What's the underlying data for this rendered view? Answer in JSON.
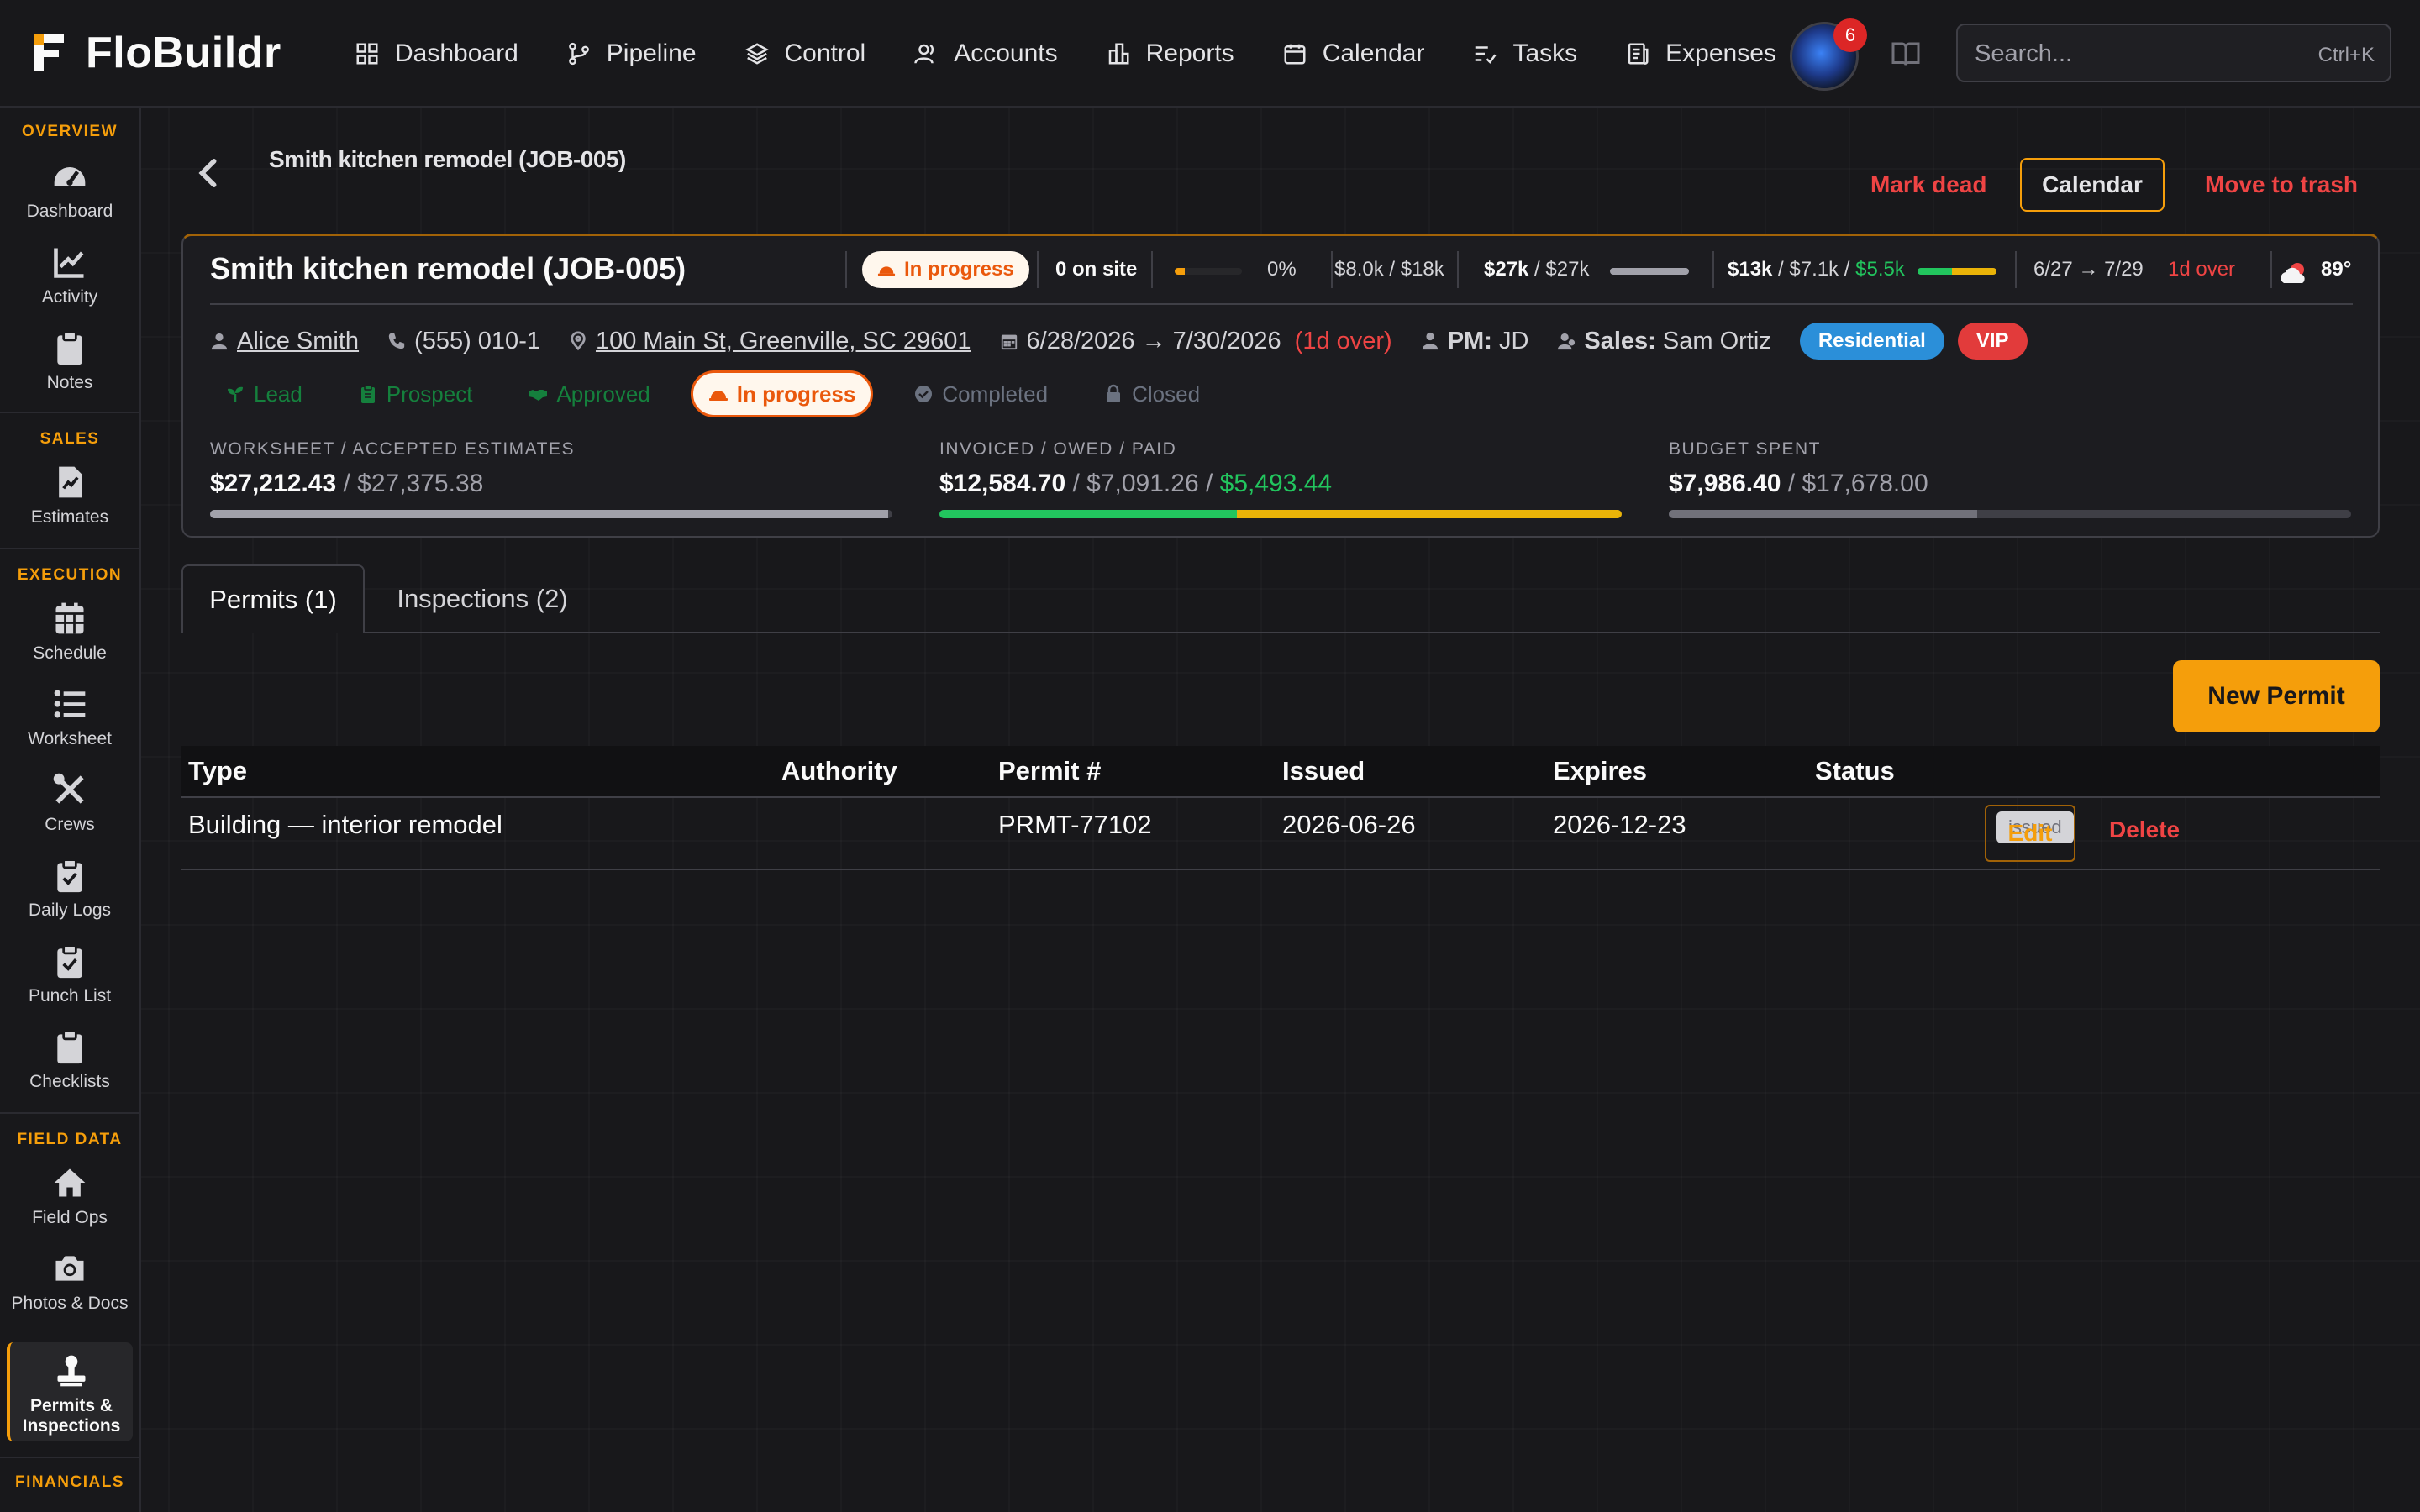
{
  "app": {
    "name": "FloBuildr"
  },
  "nav": [
    {
      "label": "Dashboard",
      "icon": "grid-icon"
    },
    {
      "label": "Pipeline",
      "icon": "branch-icon"
    },
    {
      "label": "Control",
      "icon": "layers-icon"
    },
    {
      "label": "Accounts",
      "icon": "users-icon"
    },
    {
      "label": "Reports",
      "icon": "building-icon"
    },
    {
      "label": "Calendar",
      "icon": "calendar-icon"
    },
    {
      "label": "Tasks",
      "icon": "tasks-icon"
    },
    {
      "label": "Expenses",
      "icon": "receipt-icon"
    }
  ],
  "notifications_count": "6",
  "search": {
    "placeholder": "Search...",
    "shortcut": "Ctrl+K"
  },
  "sidebar": {
    "sections": {
      "overview": "OVERVIEW",
      "sales": "SALES",
      "execution": "EXECUTION",
      "field_data": "FIELD DATA",
      "financials": "FINANCIALS"
    },
    "items": {
      "dashboard": "Dashboard",
      "activity": "Activity",
      "notes": "Notes",
      "estimates": "Estimates",
      "schedule": "Schedule",
      "worksheet": "Worksheet",
      "crews": "Crews",
      "daily_logs": "Daily Logs",
      "punch_list": "Punch List",
      "checklists": "Checklists",
      "field_ops": "Field Ops",
      "photos_docs": "Photos & Docs",
      "permits": "Permits & Inspections"
    },
    "active": "permits"
  },
  "header": {
    "breadcrumb": "Smith kitchen remodel (JOB-005)",
    "actions": {
      "mark_dead": "Mark dead",
      "calendar": "Calendar",
      "trash": "Move to trash"
    }
  },
  "job": {
    "title": "Smith kitchen remodel (JOB-005)",
    "status": "In progress",
    "on_site": "0 on site",
    "progress_pct": "0%",
    "progress_fraction": 0.15,
    "cost_summary": "$8.0k / $18k",
    "estimates_a": "$27k",
    "estimates_b": "$27k",
    "estimates_fraction": 1.0,
    "invoiced_a": "$13k",
    "invoiced_b": "$7.1k",
    "invoiced_c": "$5.5k",
    "dates_short_start": "6/27",
    "dates_short_end": "7/29",
    "overdue_short": "1d over",
    "weather_temp": "89°",
    "client": "Alice Smith",
    "phone": "(555) 010-1",
    "address": "100 Main St, Greenville, SC 29601",
    "date_range": "6/28/2026 → 7/30/2026",
    "overdue": "(1d over)",
    "pm_label": "PM:",
    "pm": "JD",
    "sales_label": "Sales:",
    "sales": "Sam Ortiz",
    "tags": [
      {
        "label": "Residential",
        "color": "#2b8fd9"
      },
      {
        "label": "VIP",
        "color": "#e23b3b"
      }
    ],
    "stages": [
      {
        "label": "Lead",
        "state": "done",
        "icon": "sprout-icon"
      },
      {
        "label": "Prospect",
        "state": "done",
        "icon": "clipboard-icon"
      },
      {
        "label": "Approved",
        "state": "done",
        "icon": "handshake-icon"
      },
      {
        "label": "In progress",
        "state": "current",
        "icon": "hardhat-icon"
      },
      {
        "label": "Completed",
        "state": "todo",
        "icon": "check-circle-icon"
      },
      {
        "label": "Closed",
        "state": "todo",
        "icon": "lock-icon"
      }
    ],
    "financials": {
      "worksheet": {
        "label": "WORKSHEET / ACCEPTED ESTIMATES",
        "a": "$27,212.43",
        "b": "$27,375.38",
        "fraction": 0.994
      },
      "invoiced": {
        "label": "INVOICED / OWED / PAID",
        "a": "$12,584.70",
        "b": "$7,091.26",
        "c": "$5,493.44",
        "paid_fraction": 0.436,
        "owed_fraction": 0.564
      },
      "budget": {
        "label": "BUDGET SPENT",
        "a": "$7,986.40",
        "b": "$17,678.00",
        "fraction": 0.452
      }
    }
  },
  "tabs": [
    {
      "label": "Permits (1)",
      "active": true
    },
    {
      "label": "Inspections (2)",
      "active": false
    }
  ],
  "new_permit_label": "New Permit",
  "table": {
    "columns": [
      "Type",
      "Authority",
      "Permit #",
      "Issued",
      "Expires",
      "Status"
    ],
    "rows": [
      {
        "type": "Building — interior remodel",
        "authority": "",
        "permit_no": "PRMT-77102",
        "issued": "2026-06-26",
        "expires": "2026-12-23",
        "status": "issued",
        "edit": "Edit",
        "delete": "Delete"
      }
    ]
  },
  "colors": {
    "accent": "#f59e0b",
    "danger": "#ef4444",
    "success": "#22c55e",
    "info": "#2b8fd9"
  }
}
